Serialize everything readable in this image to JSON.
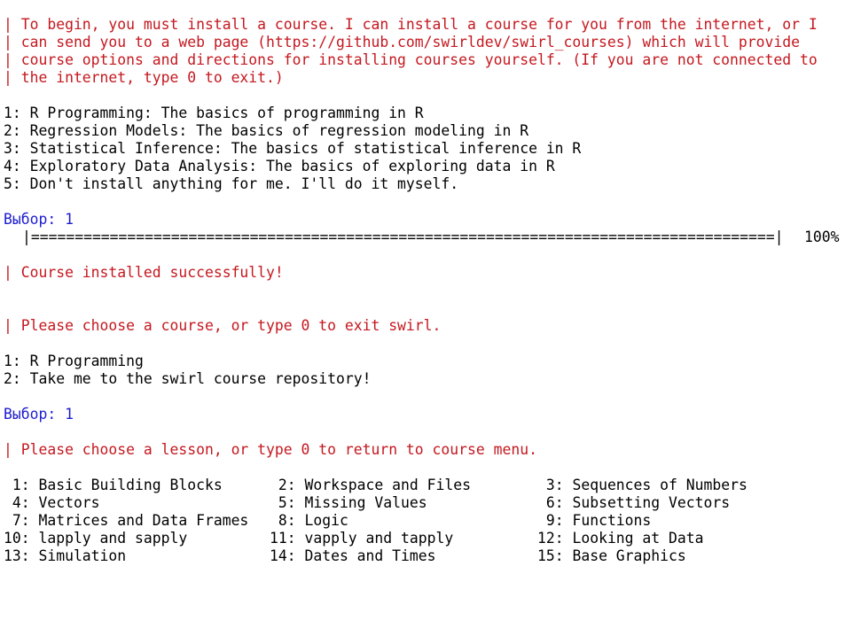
{
  "intro": {
    "lines": [
      "| To begin, you must install a course. I can install a course for you from the internet, or I",
      "| can send you to a web page (https://github.com/swirldev/swirl_courses) which will provide",
      "| course options and directions for installing courses yourself. (If you are not connected to",
      "| the internet, type 0 to exit.)"
    ]
  },
  "course_options": [
    "1: R Programming: The basics of programming in R",
    "2: Regression Models: The basics of regression modeling in R",
    "3: Statistical Inference: The basics of statistical inference in R",
    "4: Exploratory Data Analysis: The basics of exploring data in R",
    "5: Don't install anything for me. I'll do it myself."
  ],
  "selection1": "Выбор: 1",
  "progress": {
    "bar": "|=====================================================================================|",
    "percent_label": "100%",
    "value": 1.0
  },
  "installed_msg": "| Course installed successfully!",
  "choose_course_msg": "| Please choose a course, or type 0 to exit swirl.",
  "course_menu": [
    "1: R Programming",
    "2: Take me to the swirl course repository!"
  ],
  "selection2": "Выбор: 1",
  "choose_lesson_msg": "| Please choose a lesson, or type 0 to return to course menu.",
  "lessons": [
    [
      " 1: Basic Building Blocks",
      " 2: Workspace and Files",
      " 3: Sequences of Numbers"
    ],
    [
      " 4: Vectors",
      " 5: Missing Values",
      " 6: Subsetting Vectors"
    ],
    [
      " 7: Matrices and Data Frames",
      " 8: Logic",
      " 9: Functions"
    ],
    [
      "10: lapply and sapply",
      "11: vapply and tapply",
      "12: Looking at Data"
    ],
    [
      "13: Simulation",
      "14: Dates and Times",
      "15: Base Graphics"
    ]
  ],
  "colors": {
    "message_red": "#c4181f",
    "prompt_blue": "#1c1ccf",
    "text_black": "#000000",
    "background": "#ffffff"
  }
}
